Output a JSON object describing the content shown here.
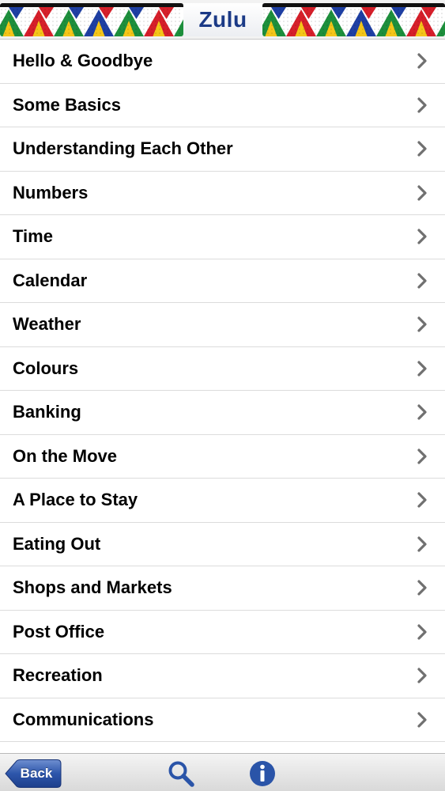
{
  "header": {
    "title": "Zulu",
    "bead_colors": [
      "#d61f2a",
      "#1d8f3c",
      "#f4c518",
      "#1e3fa3",
      "#ffffff",
      "#111111"
    ]
  },
  "menu": {
    "items": [
      {
        "label": "Hello & Goodbye"
      },
      {
        "label": "Some Basics"
      },
      {
        "label": "Understanding Each Other"
      },
      {
        "label": "Numbers"
      },
      {
        "label": "Time"
      },
      {
        "label": "Calendar"
      },
      {
        "label": "Weather"
      },
      {
        "label": "Colours"
      },
      {
        "label": "Banking"
      },
      {
        "label": "On the Move"
      },
      {
        "label": "A Place to Stay"
      },
      {
        "label": "Eating Out"
      },
      {
        "label": "Shops and Markets"
      },
      {
        "label": "Post Office"
      },
      {
        "label": "Recreation"
      },
      {
        "label": "Communications"
      }
    ],
    "chevron_icon": "chevron-right-icon"
  },
  "toolbar": {
    "back_label": "Back",
    "search_icon": "search-icon",
    "info_icon": "info-icon",
    "accent": "#2a54a8"
  }
}
